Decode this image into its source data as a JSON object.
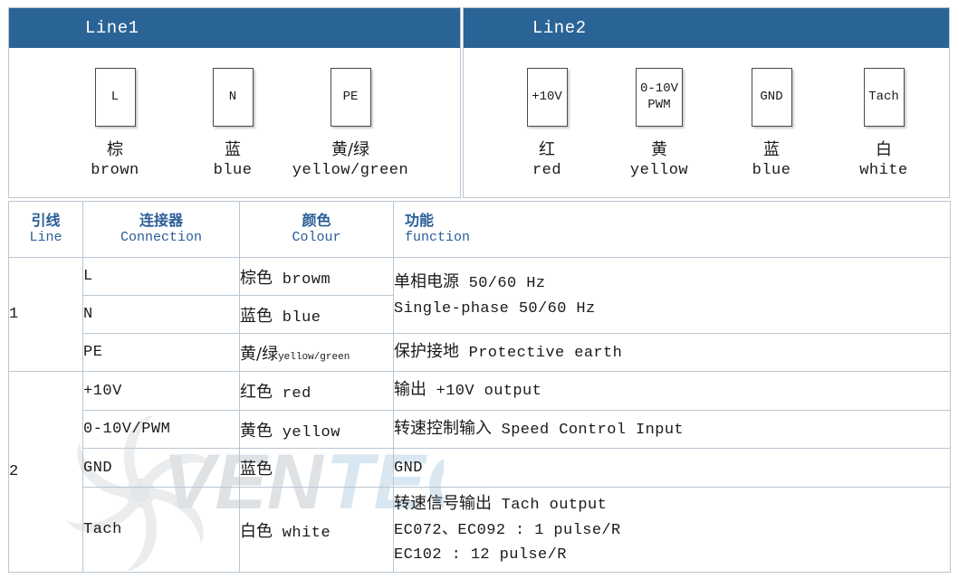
{
  "panels": [
    {
      "title": "Line1",
      "terminals": [
        {
          "box_label": "L",
          "box_label2": "",
          "cn": "棕",
          "en": "brown"
        },
        {
          "box_label": "N",
          "box_label2": "",
          "cn": "蓝",
          "en": "blue"
        },
        {
          "box_label": "PE",
          "box_label2": "",
          "cn": "黄/绿",
          "en": "yellow/green"
        }
      ]
    },
    {
      "title": "Line2",
      "terminals": [
        {
          "box_label": "+10V",
          "box_label2": "",
          "cn": "红",
          "en": "red"
        },
        {
          "box_label": "0-10V",
          "box_label2": "PWM",
          "cn": "黄",
          "en": "yellow"
        },
        {
          "box_label": "GND",
          "box_label2": "",
          "cn": "蓝",
          "en": "blue"
        },
        {
          "box_label": "Tach",
          "box_label2": "",
          "cn": "白",
          "en": "white"
        }
      ]
    }
  ],
  "table": {
    "headers": [
      {
        "cn": "引线",
        "en": "Line"
      },
      {
        "cn": "连接器",
        "en": "Connection"
      },
      {
        "cn": "颜色",
        "en": "Colour"
      },
      {
        "cn": "功能",
        "en": "function"
      }
    ],
    "groups": [
      {
        "line": "1",
        "rows": [
          {
            "connection": "L",
            "colour_cn": "棕色",
            "colour_en": "browm",
            "colour_en_tiny": false,
            "function_lines": [
              "单相电源 50/60 Hz",
              "Single-phase 50/60 Hz"
            ],
            "function_rowspan": 2
          },
          {
            "connection": "N",
            "colour_cn": "蓝色",
            "colour_en": "blue",
            "colour_en_tiny": false,
            "function_lines": [],
            "function_rowspan": 0
          },
          {
            "connection": "PE",
            "colour_cn": "黄/绿",
            "colour_en": "yellow/green",
            "colour_en_tiny": true,
            "function_lines": [
              "保护接地 Protective earth"
            ],
            "function_rowspan": 1
          }
        ]
      },
      {
        "line": "2",
        "rows": [
          {
            "connection": "+10V",
            "colour_cn": "红色",
            "colour_en": "red",
            "colour_en_tiny": false,
            "function_lines": [
              "输出 +10V output"
            ],
            "function_rowspan": 1
          },
          {
            "connection": "0-10V/PWM",
            "colour_cn": "黄色",
            "colour_en": "yellow",
            "colour_en_tiny": false,
            "function_lines": [
              "转速控制输入 Speed Control Input"
            ],
            "function_rowspan": 1
          },
          {
            "connection": "GND",
            "colour_cn": "蓝色",
            "colour_en": "",
            "colour_en_tiny": false,
            "function_lines": [
              "GND"
            ],
            "function_rowspan": 1
          },
          {
            "connection": "Tach",
            "colour_cn": "白色",
            "colour_en": "white",
            "colour_en_tiny": false,
            "function_lines": [
              "转速信号输出 Tach output",
              "EC072、EC092 : 1 pulse/R",
              "EC102 : 12 pulse/R"
            ],
            "function_rowspan": 1
          }
        ]
      }
    ]
  },
  "watermark": {
    "text": "VENTEC"
  },
  "colors": {
    "header_blue": "#2a6496",
    "header_text_blue": "#2a5e96",
    "grid_line": "#b9c6d2",
    "box_border": "#4a4a4a"
  }
}
